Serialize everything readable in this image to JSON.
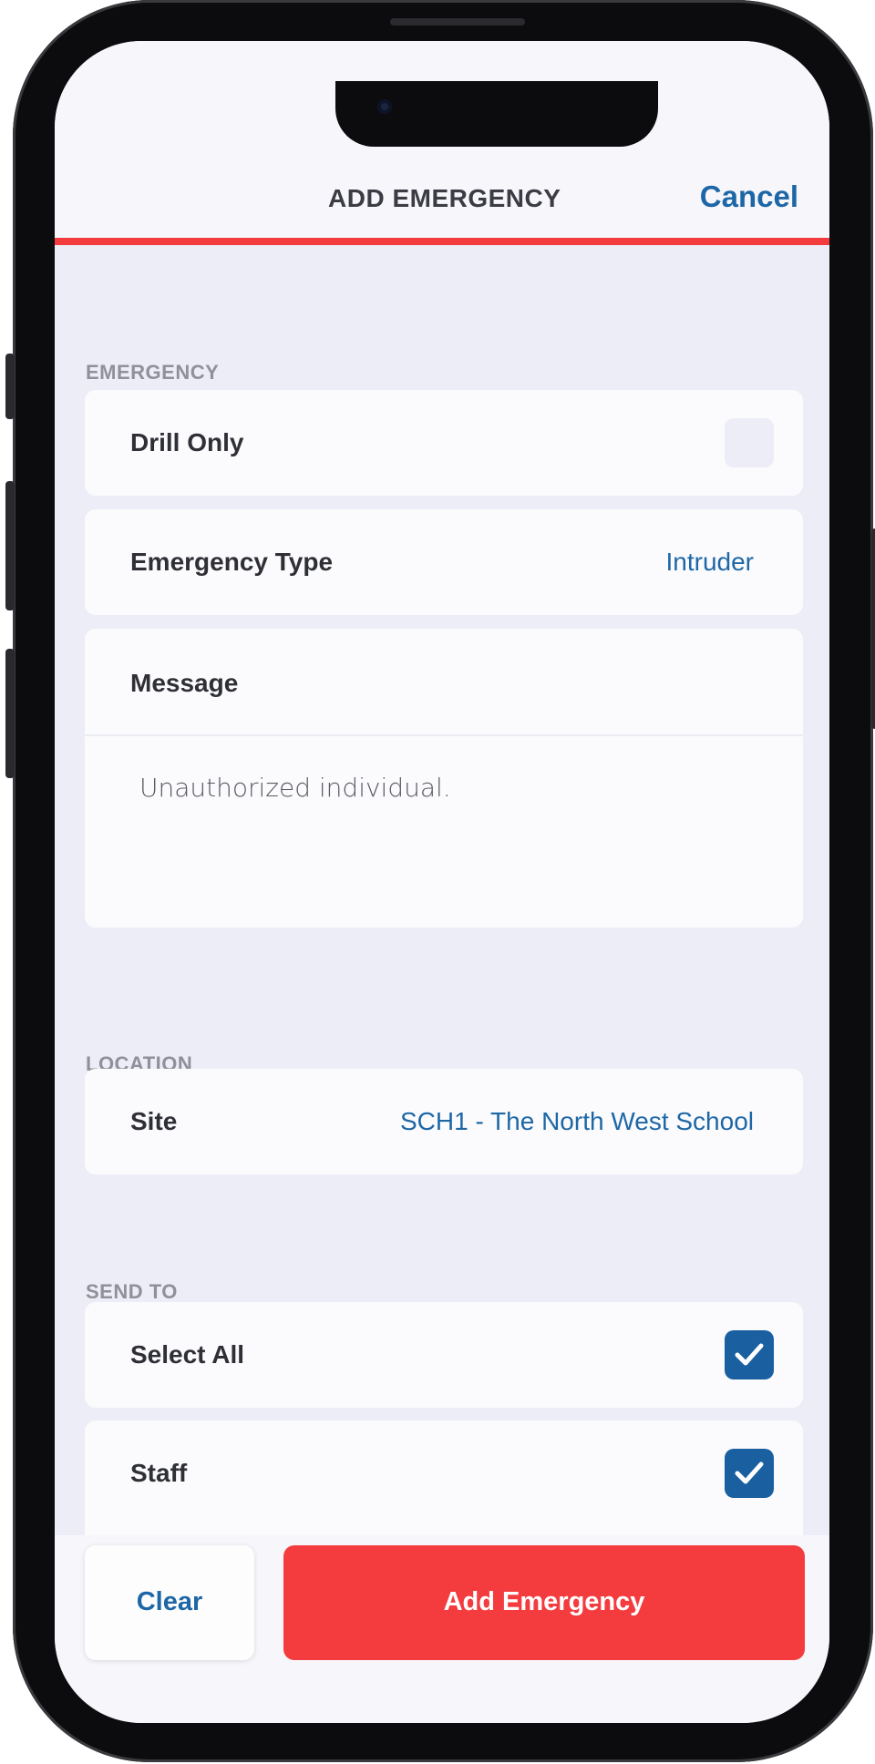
{
  "header": {
    "title": "ADD EMERGENCY",
    "cancel_label": "Cancel"
  },
  "sections": {
    "emergency_label": "EMERGENCY",
    "location_label": "LOCATION",
    "send_to_label": "SEND TO"
  },
  "emergency": {
    "drill_only_label": "Drill Only",
    "drill_only_checked": false,
    "type_label": "Emergency Type",
    "type_value": "Intruder",
    "message_label": "Message",
    "message_value": "Unauthorized individual."
  },
  "location": {
    "site_label": "Site",
    "site_value": "SCH1 - The North West School"
  },
  "send_to": {
    "select_all_label": "Select All",
    "select_all_checked": true,
    "staff_label": "Staff",
    "staff_checked": true
  },
  "actions": {
    "clear_label": "Clear",
    "add_label": "Add Emergency"
  },
  "colors": {
    "accent_red": "#f43c3f",
    "link_blue": "#1e67a6",
    "checkbox_blue": "#1a5fa0",
    "background": "#ecedf6"
  },
  "icons": {
    "checkmark": "check-icon",
    "camera": "front-camera-icon"
  }
}
